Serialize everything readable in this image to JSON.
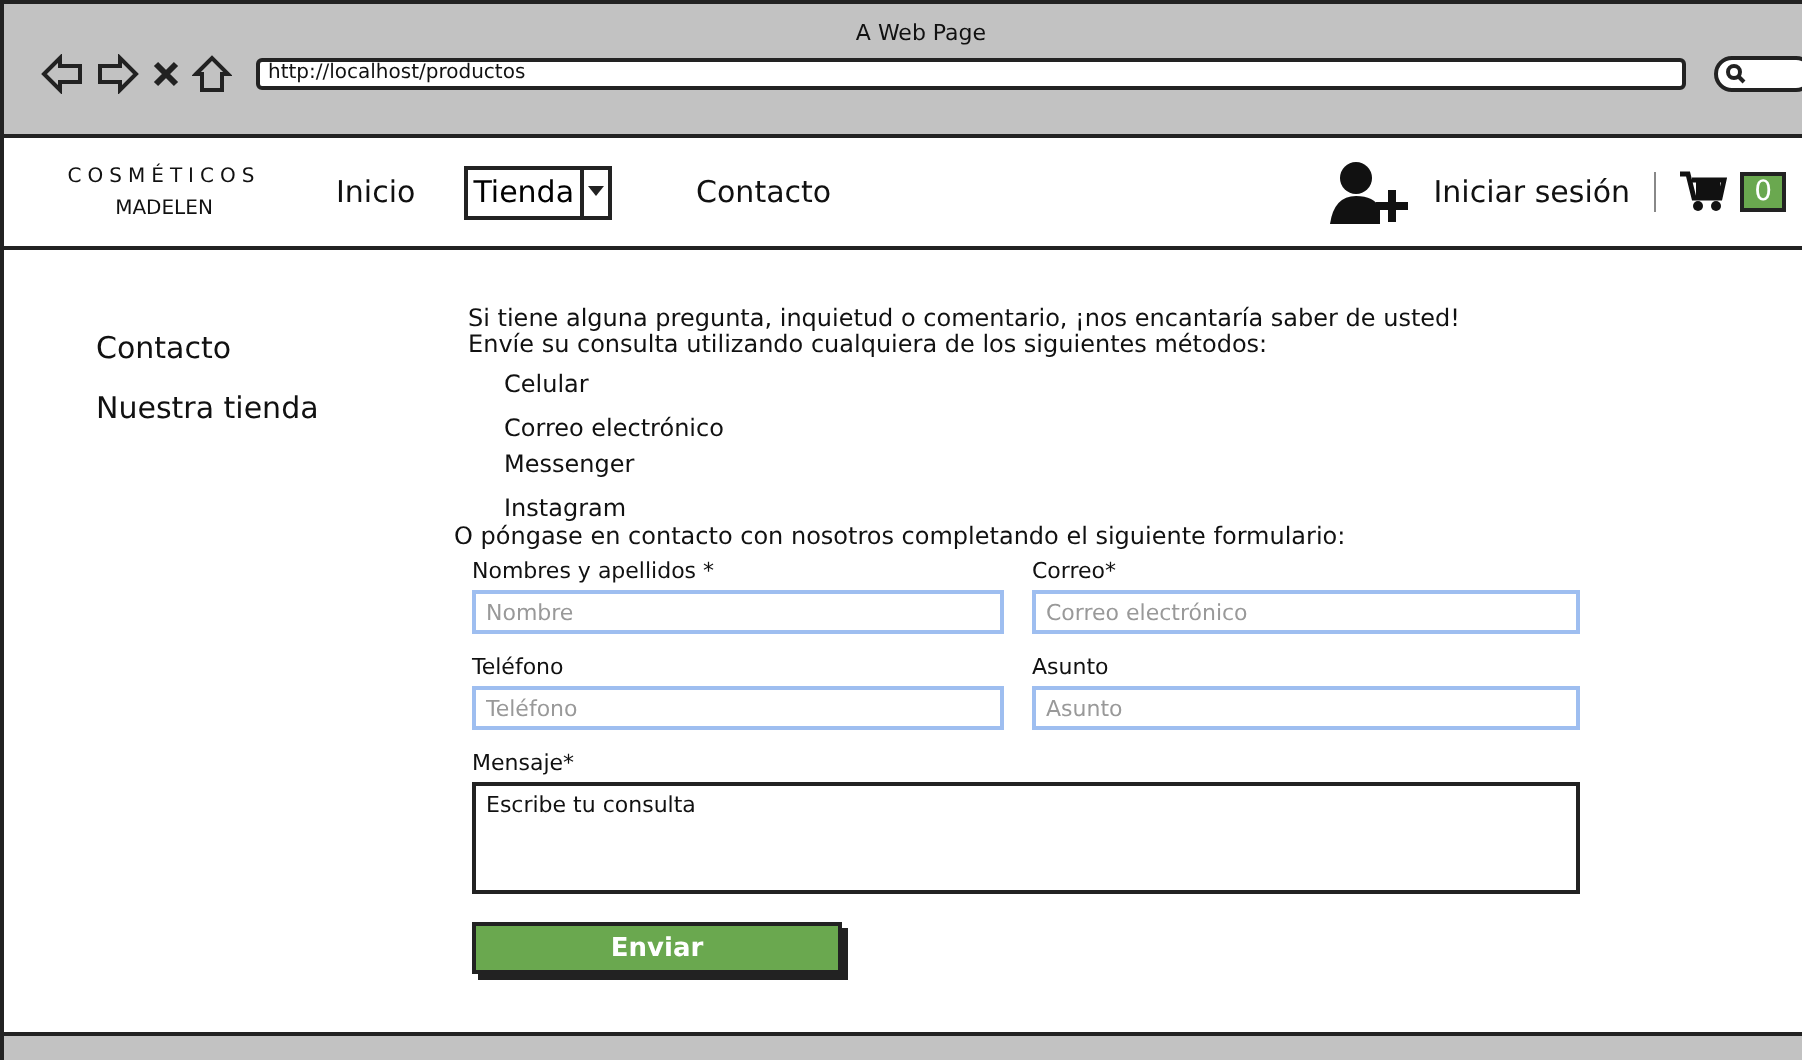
{
  "window": {
    "title": "A Web Page",
    "url": "http://localhost/productos"
  },
  "nav": {
    "logo_top": "COSMÉTICOS",
    "logo_bottom": "MADELEN",
    "links": [
      {
        "kind": "link",
        "label": "Inicio"
      },
      {
        "kind": "dropdown",
        "label": "Tienda"
      },
      {
        "kind": "link",
        "label": "Contacto"
      }
    ],
    "login": "Iniciar sesión",
    "cart_count": "0"
  },
  "sidebar": {
    "items": [
      {
        "label": "Contacto"
      },
      {
        "label": "Nuestra tienda"
      }
    ]
  },
  "intro": [
    "Si tiene alguna pregunta, inquietud o comentario, ¡nos encantaría saber de usted!",
    "Envíe su consulta utilizando cualquiera de los siguientes métodos:"
  ],
  "methods": [
    "Celular",
    "Correo electrónico",
    "Messenger",
    "Instagram"
  ],
  "form_intro": "O póngase en contacto con nosotros completando el siguiente formulario:",
  "fields": [
    {
      "label": "Nombres y apellidos *",
      "placeholder": "Nombre"
    },
    {
      "label": "Correo*",
      "placeholder": "Correo electrónico"
    },
    {
      "label": "Teléfono",
      "placeholder": "Teléfono"
    },
    {
      "label": "Asunto",
      "placeholder": "Asunto"
    }
  ],
  "message": {
    "label": "Mensaje*",
    "value": "Escribe tu consulta"
  },
  "submit": "Enviar"
}
